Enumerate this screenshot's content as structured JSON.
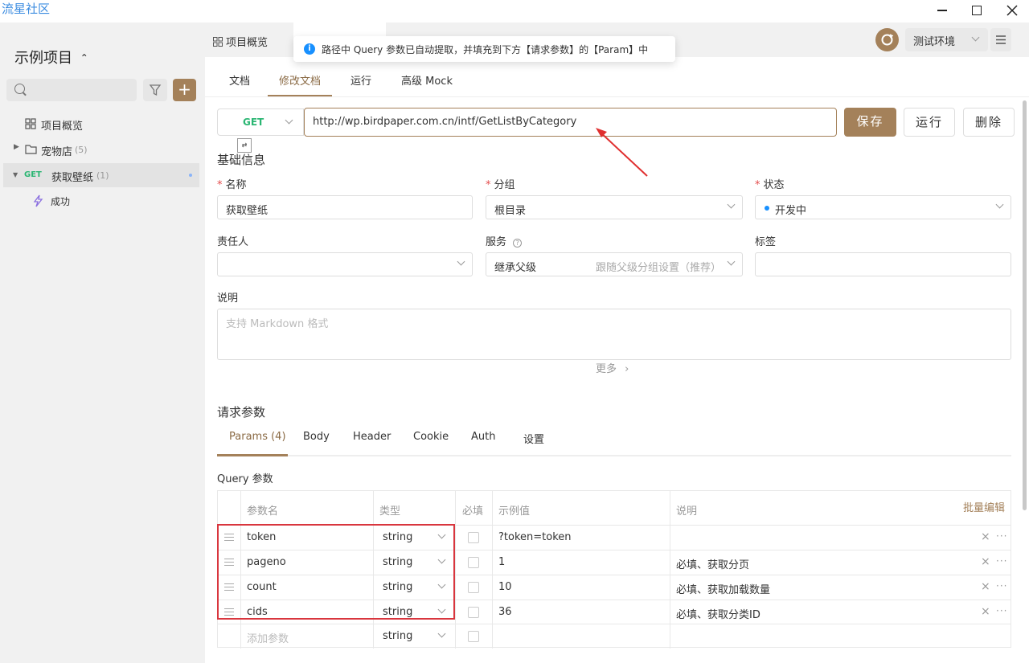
{
  "app": {
    "brand": "流星社区"
  },
  "sidebar": {
    "project_title": "示例项目",
    "items": [
      {
        "label": "项目概览"
      },
      {
        "label": "宠物店",
        "count": "(5)"
      },
      {
        "method": "GET",
        "label": "获取壁纸",
        "count": "(1)"
      },
      {
        "label": "成功"
      }
    ]
  },
  "header": {
    "tab": "项目概览",
    "env": "测试环境"
  },
  "toast": {
    "text": "路径中 Query 参数已自动提取，并填充到下方【请求参数】的【Param】中"
  },
  "subtabs": [
    "文档",
    "修改文档",
    "运行",
    "高级 Mock"
  ],
  "request": {
    "method": "GET",
    "url": "http://wp.birdpaper.com.cn/intf/GetListByCategory",
    "save": "保存",
    "run": "运行",
    "delete": "删除"
  },
  "basic": {
    "heading": "基础信息",
    "name_label": "名称",
    "name_value": "获取壁纸",
    "group_label": "分组",
    "group_value": "根目录",
    "status_label": "状态",
    "status_value": "开发中",
    "owner_label": "责任人",
    "service_label": "服务",
    "service_value": "继承父级",
    "service_hint": "跟随父级分组设置（推荐）",
    "tags_label": "标签",
    "desc_label": "说明",
    "desc_placeholder": "支持 Markdown 格式",
    "more": "更多"
  },
  "params": {
    "heading": "请求参数",
    "tabs": [
      "Params (4)",
      "Body",
      "Header",
      "Cookie",
      "Auth",
      "设置"
    ],
    "query_label": "Query 参数",
    "columns": {
      "name": "参数名",
      "type": "类型",
      "required": "必填",
      "example": "示例值",
      "desc": "说明",
      "bulk": "批量编辑"
    },
    "rows": [
      {
        "name": "token",
        "type": "string",
        "example": "?token=token",
        "desc": ""
      },
      {
        "name": "pageno",
        "type": "string",
        "example": "1",
        "desc": "必填、获取分页"
      },
      {
        "name": "count",
        "type": "string",
        "example": "10",
        "desc": "必填、获取加载数量"
      },
      {
        "name": "cids",
        "type": "string",
        "example": "36",
        "desc": "必填、获取分类ID"
      }
    ],
    "add_placeholder": "添加参数",
    "add_type": "string"
  }
}
